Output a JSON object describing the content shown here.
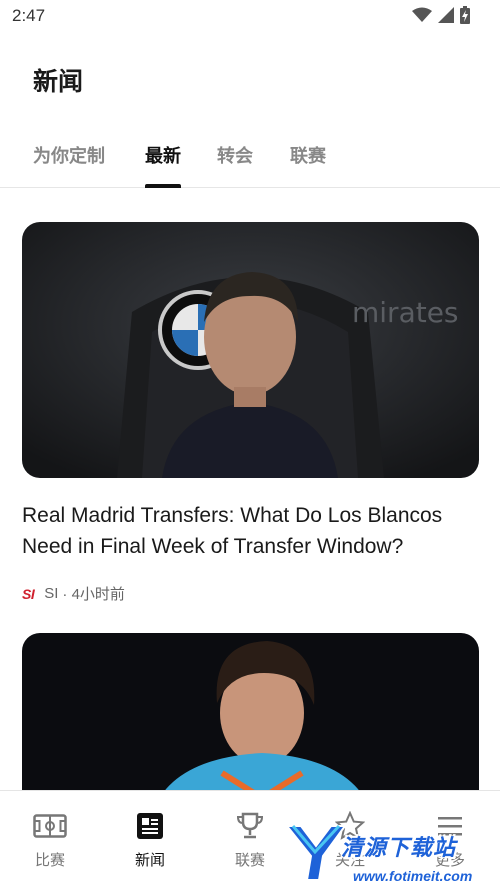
{
  "status_bar": {
    "time": "2:47"
  },
  "header": {
    "title": "新闻"
  },
  "tabs": [
    {
      "label": "为你定制",
      "active": false
    },
    {
      "label": "最新",
      "active": true
    },
    {
      "label": "转会",
      "active": false
    },
    {
      "label": "联赛",
      "active": false
    }
  ],
  "feed": [
    {
      "title": "Real Madrid Transfers: What Do Los Blancos Need in Final Week of Transfer Window?",
      "source_logo": "SI",
      "source": "SI",
      "time": "· 4小时前"
    }
  ],
  "bottom_nav": [
    {
      "label": "比赛",
      "icon": "pitch-icon",
      "active": false
    },
    {
      "label": "新闻",
      "icon": "news-icon",
      "active": true
    },
    {
      "label": "联赛",
      "icon": "trophy-icon",
      "active": false
    },
    {
      "label": "关注",
      "icon": "star-icon",
      "active": false
    },
    {
      "label": "更多",
      "icon": "menu-icon",
      "active": false
    }
  ],
  "watermark": {
    "text": "清源下载站",
    "url": "www.fotimeit.com"
  },
  "colors": {
    "accent": "#111111",
    "inactive": "#888888",
    "si_red": "#d0202e",
    "watermark_blue": "#1e62d8"
  }
}
